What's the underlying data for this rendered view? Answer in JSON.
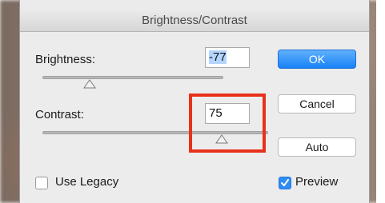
{
  "dialog": {
    "title": "Brightness/Contrast"
  },
  "brightness": {
    "label": "Brightness:",
    "value": "-77"
  },
  "contrast": {
    "label": "Contrast:",
    "value": "75"
  },
  "buttons": {
    "ok": "OK",
    "cancel": "Cancel",
    "auto": "Auto"
  },
  "checkboxes": {
    "use_legacy": {
      "label": "Use Legacy",
      "checked": false
    },
    "preview": {
      "label": "Preview",
      "checked": true
    }
  },
  "colors": {
    "accent": "#1a82f7",
    "highlight": "#e8311b"
  },
  "icons": {
    "slider_thumb": "triangle-thumb-icon",
    "check": "checkmark-icon"
  }
}
